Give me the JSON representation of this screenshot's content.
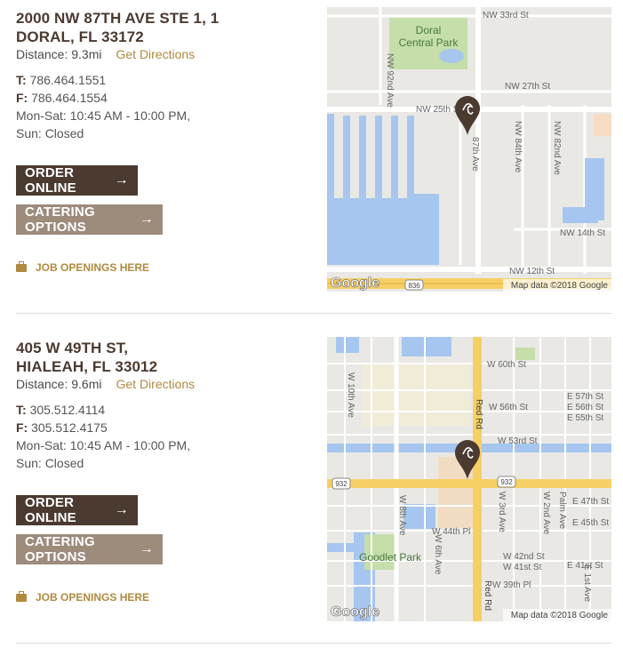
{
  "locations": [
    {
      "address_line1": "2000 NW 87TH AVE STE 1, 1",
      "address_line2": "DORAL, FL 33172",
      "distance": "Distance: 9.3mi",
      "directions": "Get Directions",
      "phone_label": "T:",
      "phone": "786.464.1551",
      "fax_label": "F:",
      "fax": "786.464.1554",
      "hours1": "Mon-Sat: 10:45 AM - 10:00 PM,",
      "hours2": "Sun: Closed",
      "order_label": "ORDER ONLINE",
      "catering_label": "CATERING OPTIONS",
      "jobs_label": "JOB OPENINGS HERE",
      "map": {
        "labels": [
          "NW 33rd St",
          "Doral",
          "Central Park",
          "NW 92nd Ave",
          "NW 27th St",
          "NW 25th St",
          "87th Ave",
          "NW 84th Ave",
          "NW 82nd Ave",
          "NW 14th St",
          "NW 12th St",
          "836"
        ],
        "google": "Google",
        "attribution": "Map data ©2018 Google"
      }
    },
    {
      "address_line1": "405 W 49TH ST,",
      "address_line2": "HIALEAH, FL 33012",
      "distance": "Distance: 9.6mi",
      "directions": "Get Directions",
      "phone_label": "T:",
      "phone": "305.512.4114",
      "fax_label": "F:",
      "fax": "305.512.4175",
      "hours1": "Mon-Sat: 10:45 AM - 10:00 PM,",
      "hours2": "Sun: Closed",
      "order_label": "ORDER ONLINE",
      "catering_label": "CATERING OPTIONS",
      "jobs_label": "JOB OPENINGS HERE",
      "map": {
        "labels": [
          "W 60th St",
          "W 10th Ave",
          "Red Rd",
          "E 57th St",
          "E 56th St",
          "E 55th St",
          "W 56th St",
          "W 53rd St",
          "932",
          "932",
          "E 47th St",
          "W 8th Ave",
          "W 3rd Ave",
          "W 2nd Ave",
          "Palm Ave",
          "E 45th St",
          "W 44th Pl",
          "W 6th Ave",
          "Goodlet Park",
          "W 42nd St",
          "W 41st St",
          "E 41st St",
          "W 39th Pl",
          "E 1st Ave",
          "Red Rd"
        ],
        "google": "Google",
        "attribution": "Map data ©2018 Google"
      }
    }
  ],
  "colors": {
    "brown": "#4b3a30",
    "tan": "#9d8b7c",
    "gold": "#b08a3e",
    "water": "#a6c6f0",
    "park": "#c5deaa"
  },
  "icons": {
    "arrow": "→",
    "jobs": "briefcase-icon",
    "pin": "chipotle-pin-icon"
  }
}
